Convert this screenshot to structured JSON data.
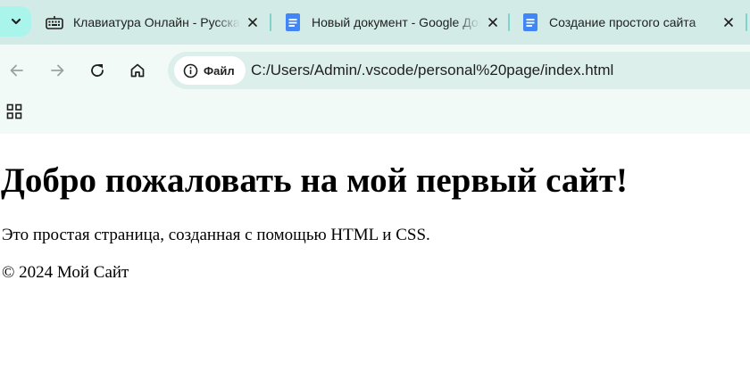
{
  "browser": {
    "tabs": [
      {
        "title": "Клавиатура Онлайн - Русская",
        "icon": "keyboard-icon"
      },
      {
        "title": "Новый документ - Google Документы",
        "icon": "google-docs-icon"
      },
      {
        "title": "Создание простого сайта",
        "icon": "google-docs-icon"
      }
    ],
    "address": {
      "chip_label": "Файл",
      "url": "C:/Users/Admin/.vscode/personal%20page/index.html"
    }
  },
  "page": {
    "heading": "Добро пожаловать на мой первый сайт!",
    "intro": "Это простая страница, созданная с помощью HTML и CSS.",
    "footer": "© 2024 Мой Сайт"
  },
  "colors": {
    "tabstrip_bg": "#d3ebe6",
    "toolbar_bg": "#f2faf8",
    "accent": "#a9f5ec",
    "docs_blue": "#4285f4"
  }
}
